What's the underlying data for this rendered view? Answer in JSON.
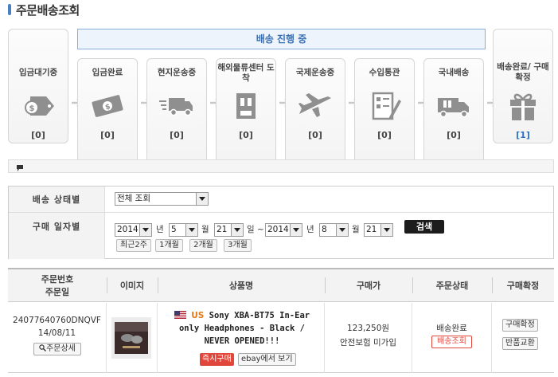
{
  "page": {
    "title": "주문배송조회"
  },
  "progress": {
    "banner": "배송 진행 중",
    "stages": [
      {
        "label": "입금대기중",
        "count": "[0]",
        "icon": "coin-tag-icon"
      },
      {
        "label": "입금완료",
        "count": "[0]",
        "icon": "money-bill-icon"
      },
      {
        "label": "현지운송중",
        "count": "[0]",
        "icon": "speeding-truck-icon"
      },
      {
        "label": "해외물류센터 도착",
        "count": "[0]",
        "icon": "warehouse-box-icon"
      },
      {
        "label": "국제운송중",
        "count": "[0]",
        "icon": "airplane-icon"
      },
      {
        "label": "수입통관",
        "count": "[0]",
        "icon": "customs-form-icon"
      },
      {
        "label": "국내배송",
        "count": "[0]",
        "icon": "delivery-truck-icon"
      },
      {
        "label": "배송완료/ 구매확정",
        "count": "[1]",
        "icon": "gift-box-icon"
      }
    ]
  },
  "filters": {
    "status_label": "배송 상태별",
    "status_value": "전체 조회",
    "date_label": "구매 일자별",
    "from_year": "2014",
    "from_month": "5",
    "from_day": "21",
    "to_year": "2014",
    "to_month": "8",
    "to_day": "21",
    "unit_year": "년",
    "unit_month": "월",
    "unit_day": "일",
    "tilde": "~",
    "search_button": "검색",
    "quick": [
      "최근2주",
      "1개월",
      "2개월",
      "3개월"
    ]
  },
  "table": {
    "headers": {
      "order_no_line1": "주문번호",
      "order_no_line2": "주문일",
      "image": "이미지",
      "product": "상품명",
      "price": "구매가",
      "status": "주문상태",
      "confirm": "구매확정"
    },
    "rows": [
      {
        "order_no": "24077640760DNQVF",
        "order_date": "14/08/11",
        "detail_button": "주문상세",
        "country": "US",
        "product_name": "Sony XBA-BT75 In-Ear only Headphones - Black / NEVER OPENED!!!",
        "buy_now_badge": "즉시구매",
        "ebay_button": "ebay에서 보기",
        "price": "123,250원",
        "insurance": "안전보험 미가입",
        "status": "배송완료",
        "track_button": "배송조회",
        "confirm_button": "구매확정",
        "return_button": "반품교환"
      }
    ]
  },
  "colors": {
    "accent_blue": "#2a72c9",
    "badge_red": "#e0463a",
    "banner_border": "#8aaedb"
  }
}
